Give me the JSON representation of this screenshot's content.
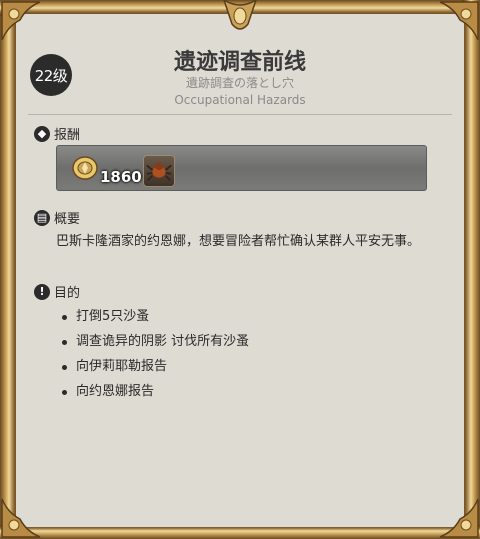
{
  "quest": {
    "level": "22级",
    "title": "遗迹调查前线",
    "subtitle_jp": "遺跡調査の落とし穴",
    "subtitle_en": "Occupational Hazards"
  },
  "rewards": {
    "heading": "报酬",
    "gil_amount": "1860",
    "gil_icon": "gil-coin-icon",
    "item_icon": "spider-item-icon"
  },
  "summary": {
    "heading": "概要",
    "text": "巴斯卡隆酒家的约恩娜，想要冒险者帮忙确认某群人平安无事。"
  },
  "objectives": {
    "heading": "目的",
    "items": [
      "打倒5只沙蚤",
      "调查诡异的阴影 讨伐所有沙蚤",
      "向伊莉耶勒报告",
      "向约恩娜报告"
    ]
  },
  "colors": {
    "panel": "#dedbd3",
    "frame_gold": "#c9a35a",
    "text": "#2a2a2a"
  }
}
